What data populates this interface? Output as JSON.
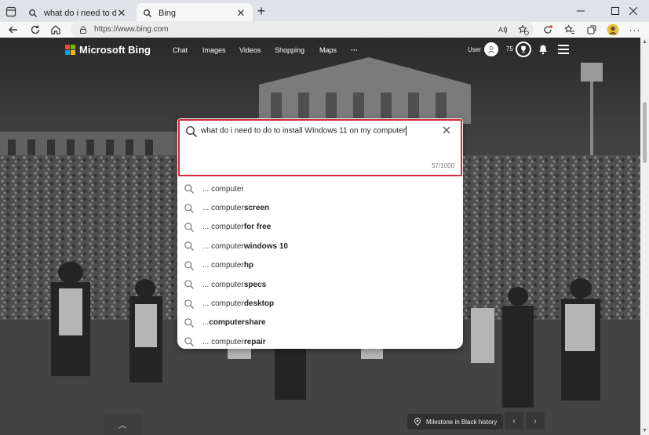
{
  "browser": {
    "tabs": [
      {
        "title": "what do i need to do to install W",
        "active": false
      },
      {
        "title": "Bing",
        "active": true
      }
    ],
    "address": "https://www.bing.com"
  },
  "bing": {
    "brand": "Microsoft Bing",
    "nav": [
      "Chat",
      "Images",
      "Videos",
      "Shopping",
      "Maps",
      "···"
    ],
    "user_label": "User",
    "rewards_count": "75"
  },
  "search": {
    "query": "what do i need to do to install WIndows 11 on my computer",
    "char_count": "57/1000",
    "suggestions": [
      {
        "prefix": "... computer",
        "bold": ""
      },
      {
        "prefix": "... computer ",
        "bold": "screen"
      },
      {
        "prefix": "... computer ",
        "bold": "for free"
      },
      {
        "prefix": "... computer ",
        "bold": "windows 10"
      },
      {
        "prefix": "... computer ",
        "bold": "hp"
      },
      {
        "prefix": "... computer ",
        "bold": "specs"
      },
      {
        "prefix": "... computer ",
        "bold": "desktop"
      },
      {
        "prefix": "... ",
        "bold": "computershare"
      },
      {
        "prefix": "... computer ",
        "bold": "repair"
      }
    ]
  },
  "footer": {
    "image_caption": "Milestone in Black history"
  },
  "colors": {
    "focus_border": "#d22839",
    "ms_red": "#f25022",
    "ms_green": "#7fba00",
    "ms_blue": "#00a4ef",
    "ms_yellow": "#ffb900"
  }
}
